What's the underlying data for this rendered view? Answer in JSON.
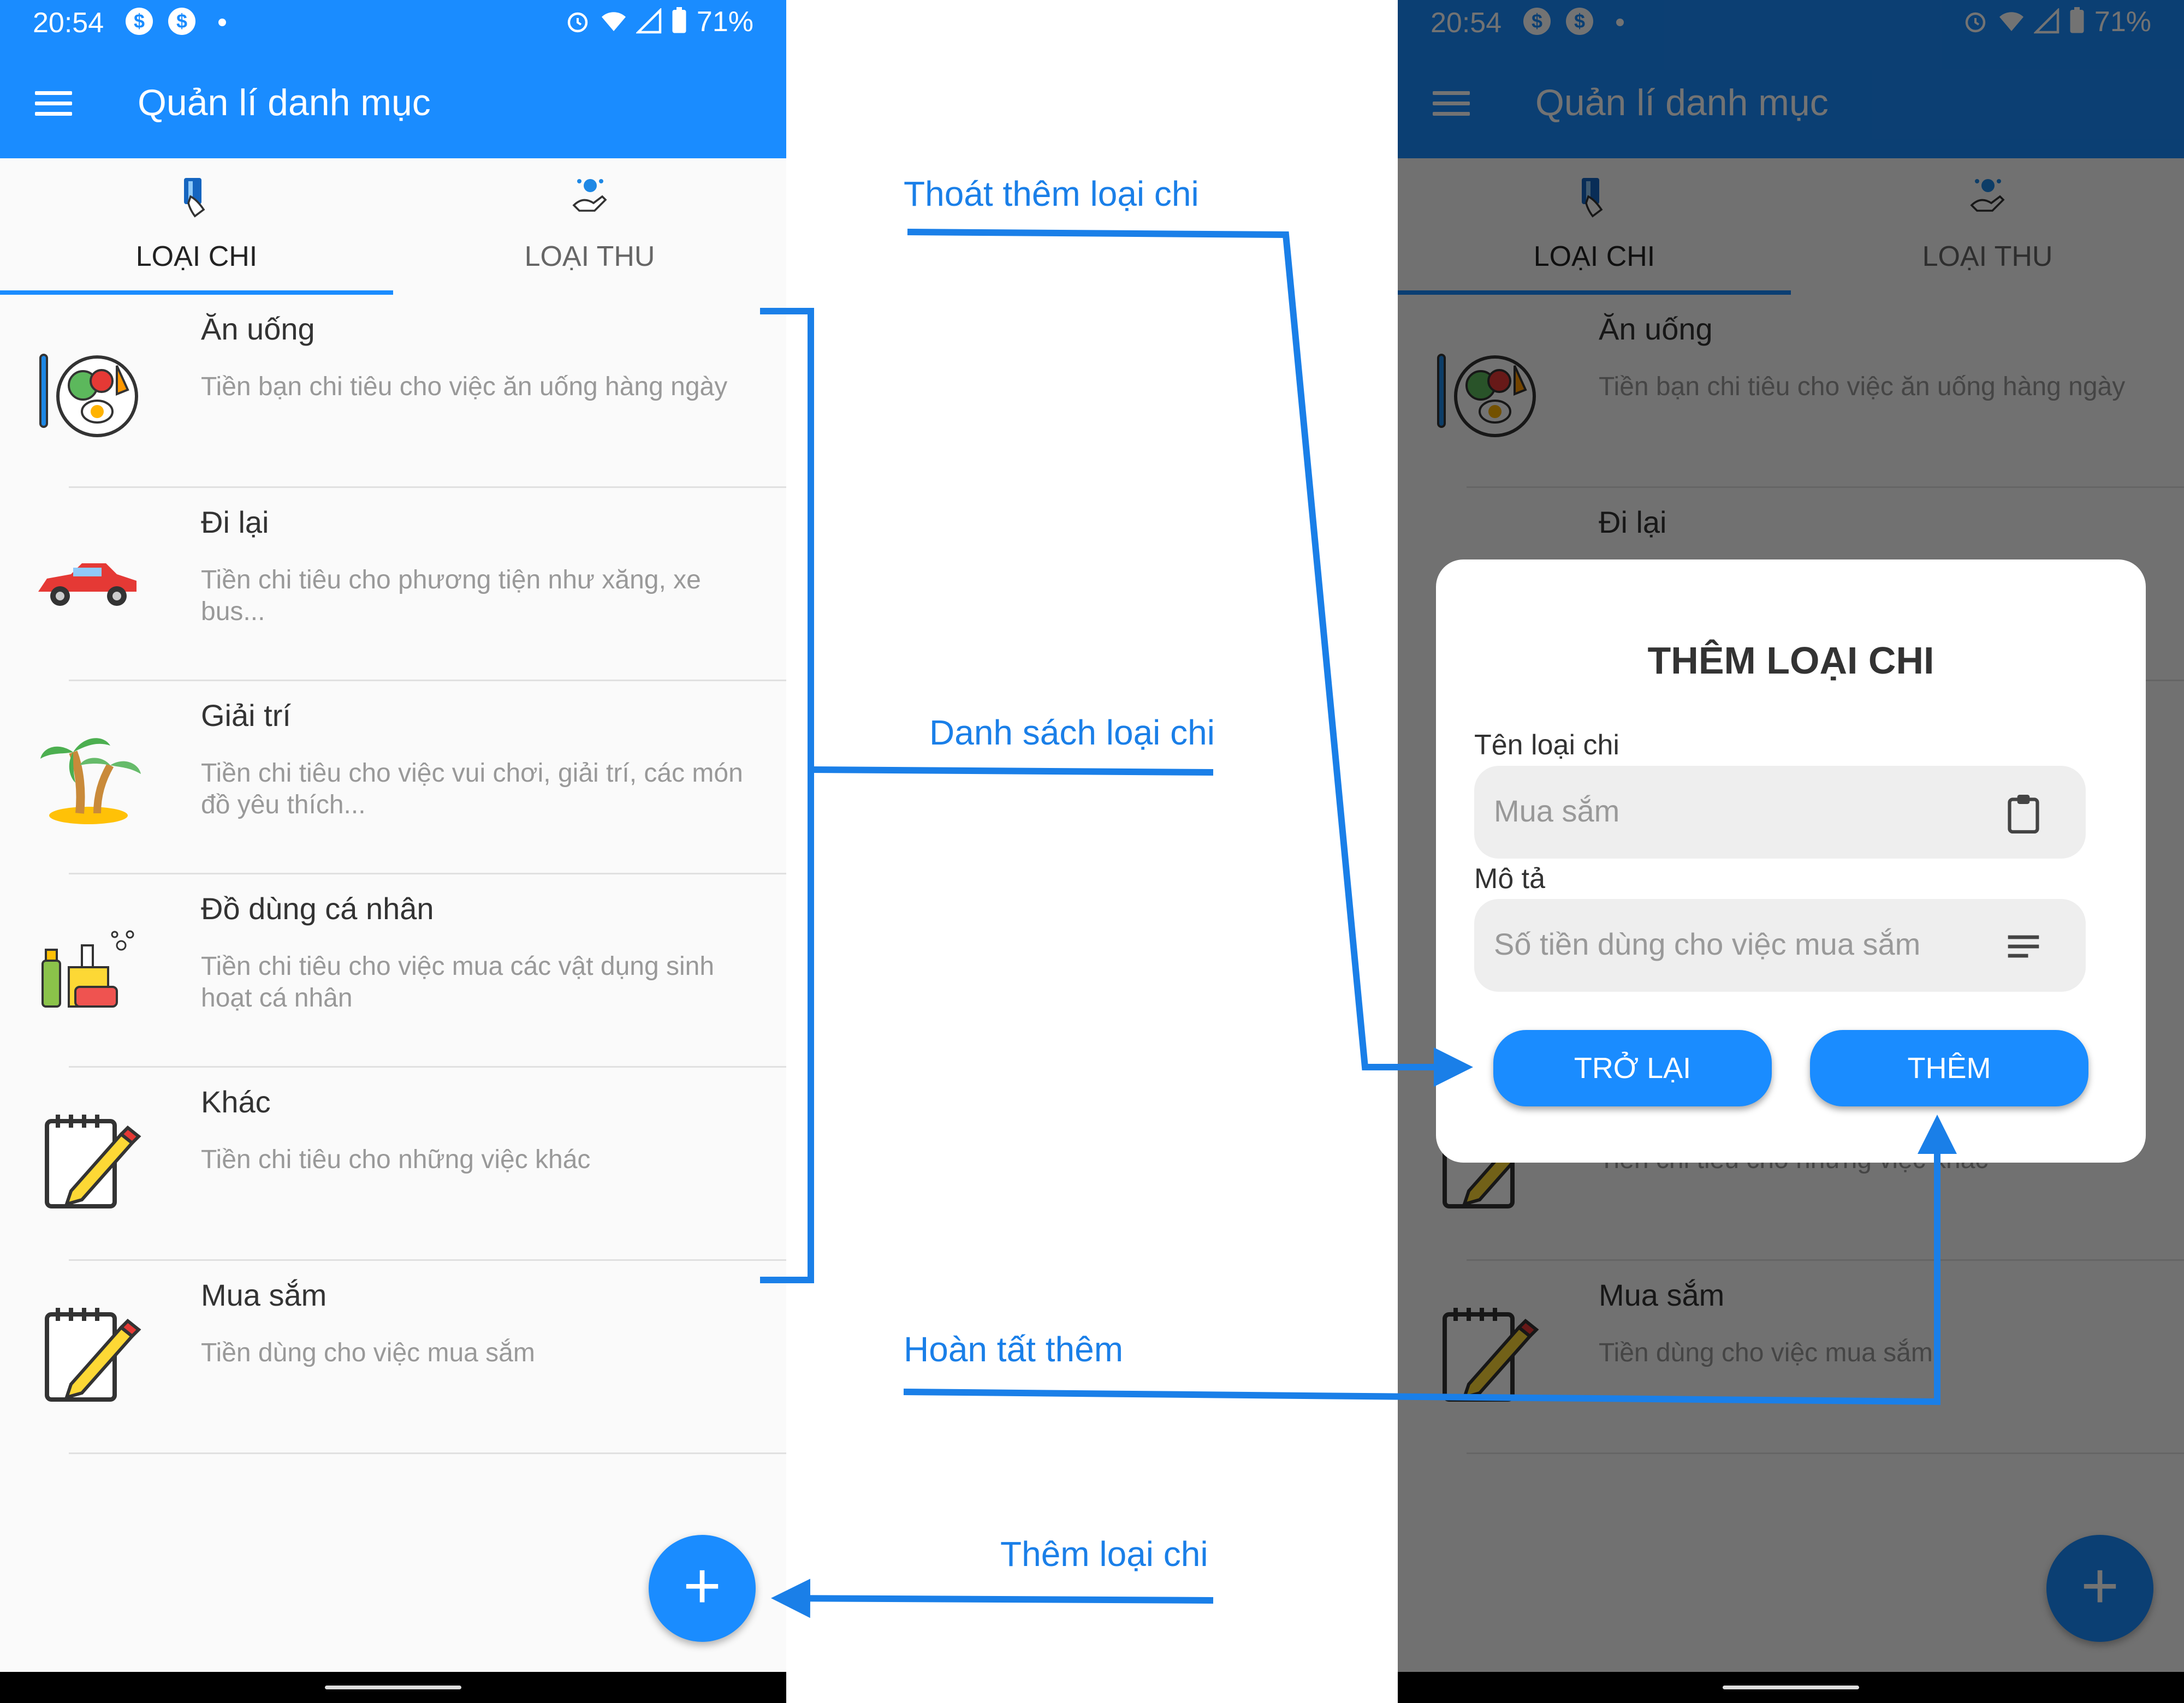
{
  "status": {
    "time": "20:54",
    "battery": "71%"
  },
  "app": {
    "title": "Quản lí danh mục"
  },
  "tabs": [
    {
      "label": "LOẠI CHI"
    },
    {
      "label": "LOẠI THU"
    }
  ],
  "categories": [
    {
      "title": "Ăn uống",
      "desc": "Tiền bạn chi tiêu cho việc ăn uống hàng ngày",
      "icon": "food-icon"
    },
    {
      "title": "Đi lại",
      "desc": "Tiền chi tiêu cho phương tiện như xăng, xe bus...",
      "icon": "car-icon"
    },
    {
      "title": "Giải trí",
      "desc": "Tiền chi tiêu cho việc vui chơi, giải trí, các món đồ yêu thích...",
      "icon": "palm-tree-icon"
    },
    {
      "title": "Đồ dùng cá nhân",
      "desc": "Tiền chi tiêu cho việc mua các vật dụng sinh hoạt cá nhân",
      "icon": "toiletries-icon"
    },
    {
      "title": "Khác",
      "desc": "Tiền chi tiêu cho những việc khác",
      "icon": "notepad-pencil-icon"
    },
    {
      "title": "Mua sắm",
      "desc": "Tiền dùng cho việc mua sắm",
      "icon": "notepad-pencil-icon"
    }
  ],
  "fab": {
    "symbol": "+"
  },
  "dialog": {
    "title": "THÊM LOẠI CHI",
    "name_label": "Tên loại chi",
    "name_placeholder": "Mua sắm",
    "desc_label": "Mô tả",
    "desc_placeholder": "Số tiền dùng cho việc mua sắm",
    "back_label": "TRỞ LẠI",
    "add_label": "THÊM"
  },
  "annotations": {
    "exit_add": "Thoát thêm loại chi",
    "list": "Danh sách loại chi",
    "complete_add": "Hoàn tất thêm",
    "add_category": "Thêm loại chi"
  },
  "colors": {
    "primary": "#1a8cff",
    "primary_dark": "#0d4f8f",
    "annotation": "#1a7fe8"
  }
}
